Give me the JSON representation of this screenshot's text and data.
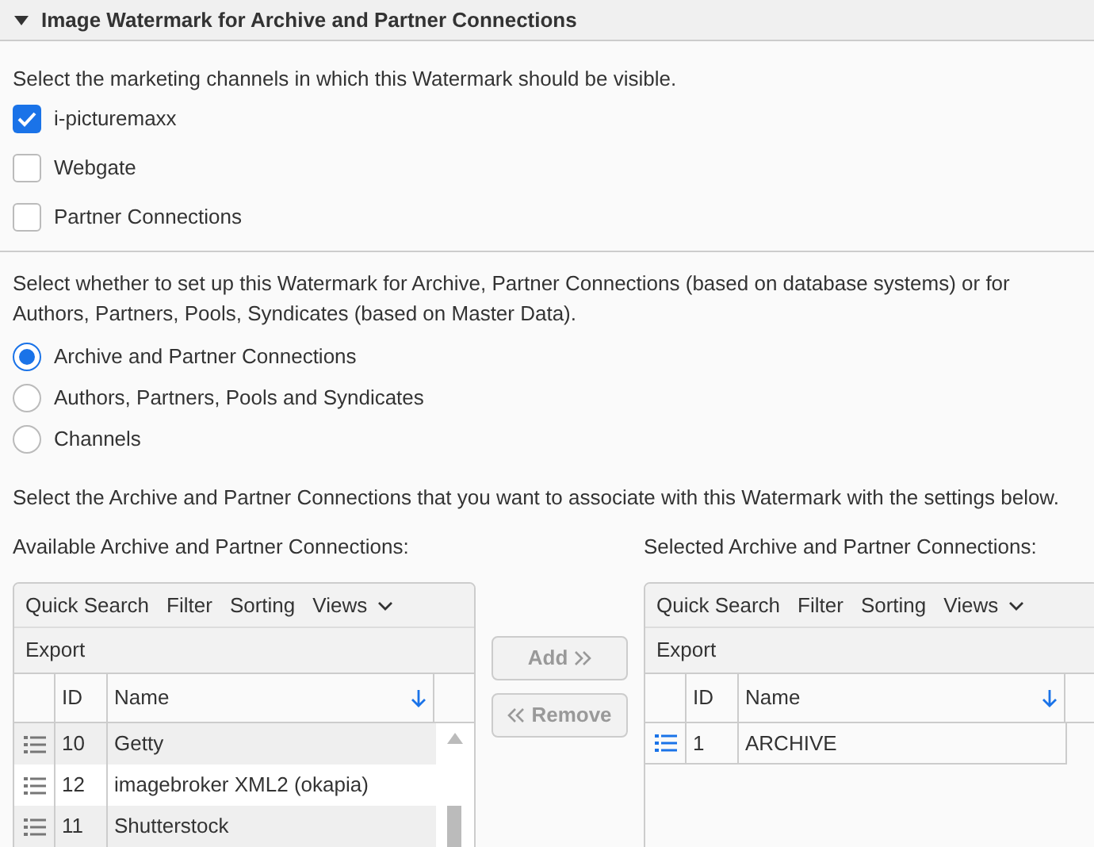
{
  "section": {
    "title": "Image Watermark for Archive and Partner Connections",
    "expanded": true
  },
  "channels_intro": "Select the marketing channels in which this Watermark should be visible.",
  "channels": [
    {
      "label": "i-picturemaxx",
      "checked": true
    },
    {
      "label": "Webgate",
      "checked": false
    },
    {
      "label": "Partner Connections",
      "checked": false
    }
  ],
  "setup_intro": "Select whether to set up this Watermark for Archive, Partner Connections (based on database systems) or for Authors, Partners, Pools, Syndicates (based on Master Data).",
  "setup_options": [
    {
      "label": "Archive and Partner Connections",
      "selected": true
    },
    {
      "label": "Authors, Partners, Pools and Syndicates",
      "selected": false
    },
    {
      "label": "Channels",
      "selected": false
    }
  ],
  "connections_intro": "Select the Archive and Partner Connections that you want to associate with this Watermark with the settings below.",
  "available": {
    "title": "Available Archive and Partner Connections:",
    "toolbar": [
      "Quick Search",
      "Filter",
      "Sorting",
      "Views"
    ],
    "export": "Export",
    "columns": [
      "ID",
      "Name"
    ],
    "rows": [
      {
        "id": "10",
        "name": "Getty",
        "selected": false
      },
      {
        "id": "12",
        "name": "imagebroker XML2 (okapia)",
        "selected": false
      },
      {
        "id": "11",
        "name": "Shutterstock",
        "selected": false
      }
    ]
  },
  "buttons": [
    {
      "label": "Add",
      "kind": "add",
      "disabled": true
    },
    {
      "label": "Remove",
      "kind": "remove",
      "disabled": true
    }
  ],
  "selected": {
    "title": "Selected Archive and Partner Connections:",
    "toolbar": [
      "Quick Search",
      "Filter",
      "Sorting",
      "Views"
    ],
    "export": "Export",
    "columns": [
      "ID",
      "Name"
    ],
    "rows": [
      {
        "id": "1",
        "name": "ARCHIVE",
        "selected": true
      }
    ]
  }
}
